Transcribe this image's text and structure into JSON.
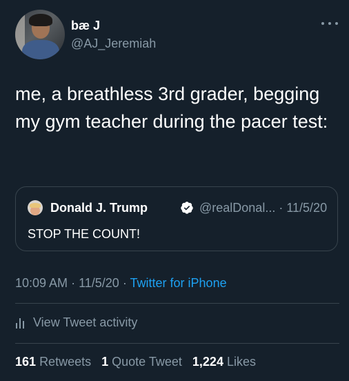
{
  "author": {
    "display_name": "bæ J",
    "handle": "@AJ_Jeremiah"
  },
  "tweet": {
    "text": "me, a breathless 3rd grader, begging my gym teacher during the pacer test:"
  },
  "quoted_tweet": {
    "display_name": "Donald J. Trump",
    "handle": "@realDonal...",
    "separator": "·",
    "date": "11/5/20",
    "text": "STOP THE COUNT!",
    "verified": true
  },
  "meta": {
    "time": "10:09 AM",
    "date": "11/5/20",
    "sep": "·",
    "source": "Twitter for iPhone"
  },
  "activity": {
    "label": "View Tweet activity"
  },
  "stats": {
    "retweets_count": "161",
    "retweets_label": "Retweets",
    "quotes_count": "1",
    "quotes_label": "Quote Tweet",
    "likes_count": "1,224",
    "likes_label": "Likes"
  },
  "colors": {
    "background": "#15202b",
    "secondary_text": "#8899a6",
    "accent": "#1da1f2",
    "border": "#38444d"
  }
}
